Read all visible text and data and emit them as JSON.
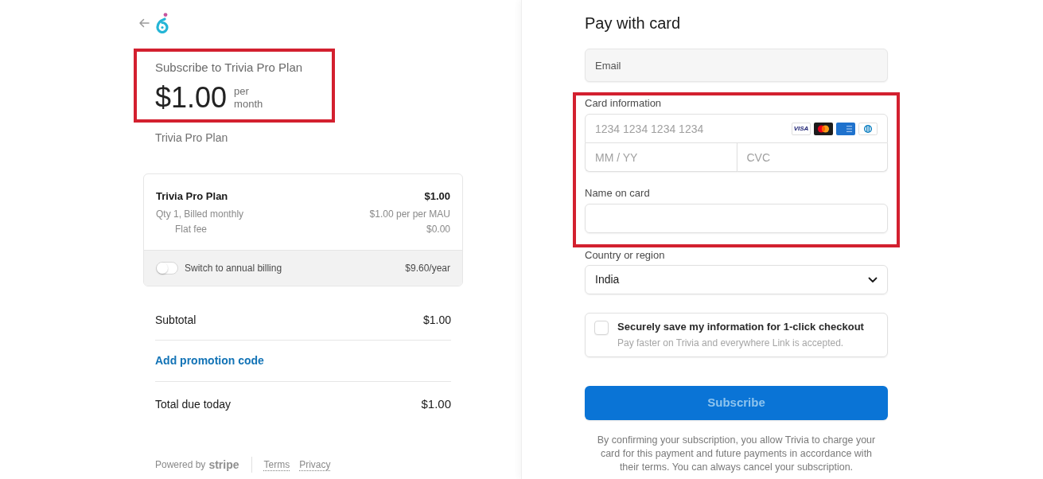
{
  "summary": {
    "highlighted": true,
    "title": "Subscribe to Trivia Pro Plan",
    "price": "$1.00",
    "period": "per month",
    "product_name": "Trivia Pro Plan"
  },
  "line_item": {
    "name": "Trivia Pro Plan",
    "price": "$1.00",
    "details": [
      {
        "kind": "billing",
        "label": "Qty 1, Billed monthly",
        "value": "$1.00 per per MAU"
      },
      {
        "kind": "fee",
        "label": "Flat fee",
        "value": "$0.00"
      }
    ]
  },
  "annual_billing": {
    "label": "Switch to annual billing",
    "price": "$9.60/year",
    "on": false
  },
  "totals": [
    {
      "kind": "subtotal",
      "label": "Subtotal",
      "value": "$1.00"
    },
    {
      "kind": "link",
      "label": "Add promotion code"
    },
    {
      "kind": "total",
      "label": "Total due today",
      "value": "$1.00"
    }
  ],
  "footer": {
    "powered_by": "Powered by",
    "brand": "stripe",
    "links": [
      "Terms",
      "Privacy"
    ]
  },
  "payment": {
    "title": "Pay with card",
    "email": {
      "placeholder": "Email"
    },
    "card_section": {
      "highlighted": true,
      "label": "Card information",
      "number_placeholder": "1234 1234 1234 1234",
      "brands": [
        {
          "kind": "visa",
          "label": "VISA"
        },
        {
          "kind": "mastercard"
        },
        {
          "kind": "amex"
        },
        {
          "kind": "diners"
        }
      ],
      "expiry_placeholder": "MM / YY",
      "cvc_placeholder": "CVC",
      "name_label": "Name on card"
    },
    "country": {
      "label": "Country or region",
      "value": "India"
    },
    "save_info": {
      "checked": false,
      "title": "Securely save my information for 1-click checkout",
      "subtitle": "Pay faster on Trivia and everywhere Link is accepted."
    },
    "submit": {
      "label": "Subscribe",
      "disabled": true
    },
    "legal": "By confirming your subscription, you allow Trivia to charge your card for this payment and future payments in accordance with their terms. You can always cancel your subscription."
  }
}
